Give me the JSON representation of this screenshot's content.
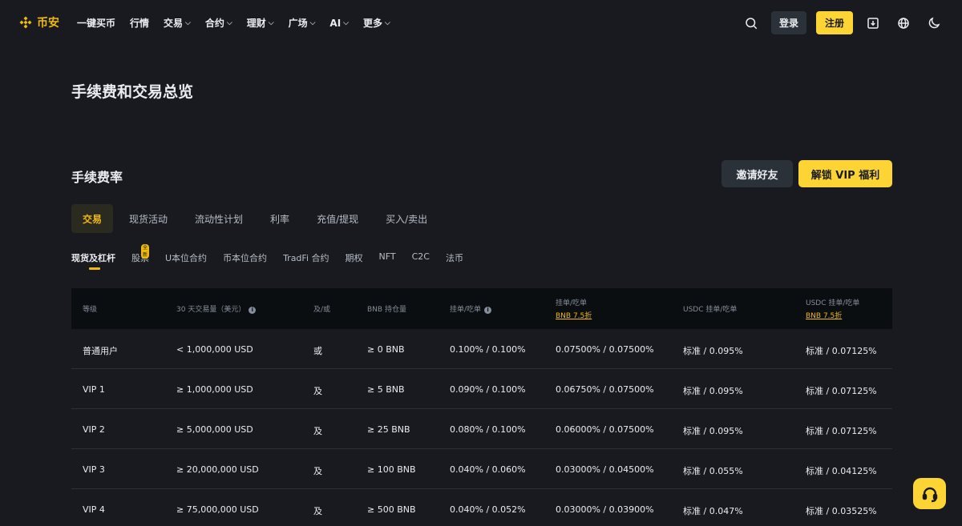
{
  "brand": {
    "name": "币安"
  },
  "nav": {
    "items": [
      {
        "label": "一键买币",
        "chevron": false
      },
      {
        "label": "行情",
        "chevron": false
      },
      {
        "label": "交易",
        "chevron": true
      },
      {
        "label": "合约",
        "chevron": true
      },
      {
        "label": "理财",
        "chevron": true
      },
      {
        "label": "广场",
        "chevron": true
      },
      {
        "label": "AI",
        "chevron": true
      },
      {
        "label": "更多",
        "chevron": true
      }
    ],
    "login_label": "登录",
    "signup_label": "注册"
  },
  "page": {
    "title": "手续费和交易总览"
  },
  "fees": {
    "section_title": "手续费率",
    "invite_label": "邀请好友",
    "vip_label": "解锁 VIP 福利",
    "tabs": [
      "交易",
      "现货活动",
      "流动性计划",
      "利率",
      "充值/提现",
      "买入/卖出"
    ],
    "active_tab": "交易",
    "subtabs": [
      "现货及杠杆",
      "股票",
      "U本位合约",
      "币本位合约",
      "TradFi 合约",
      "期权",
      "NFT",
      "C2C",
      "法币"
    ],
    "new_badge": "全新"
  },
  "table": {
    "headers": {
      "level": "等级",
      "volume": "30 天交易量（美元）",
      "andor": "及/或",
      "bnb": "BNB 持仓量",
      "maker_taker": "挂单/吃单",
      "bnb_mt": "挂单/吃单",
      "bnb_discount": "BNB 7.5折",
      "usdc_mt": "USDC 挂单/吃单",
      "usdc_bnb_mt": "USDC 挂单/吃单",
      "usdc_bnb_discount": "BNB 7.5折"
    },
    "rows": [
      {
        "level": "普通用户",
        "volume": "< 1,000,000 USD",
        "andor": "或",
        "bnb": "≥ 0 BNB",
        "mt": "0.100% / 0.100%",
        "bnb_mt": "0.07500% / 0.07500%",
        "usdc": "标准 / 0.095%",
        "usdc_bnb": "标准 / 0.07125%"
      },
      {
        "level": "VIP 1",
        "volume": "≥ 1,000,000 USD",
        "andor": "及",
        "bnb": "≥ 5 BNB",
        "mt": "0.090% / 0.100%",
        "bnb_mt": "0.06750% / 0.07500%",
        "usdc": "标准 / 0.095%",
        "usdc_bnb": "标准 / 0.07125%"
      },
      {
        "level": "VIP 2",
        "volume": "≥ 5,000,000 USD",
        "andor": "及",
        "bnb": "≥ 25 BNB",
        "mt": "0.080% / 0.100%",
        "bnb_mt": "0.06000% / 0.07500%",
        "usdc": "标准 / 0.095%",
        "usdc_bnb": "标准 / 0.07125%"
      },
      {
        "level": "VIP 3",
        "volume": "≥ 20,000,000 USD",
        "andor": "及",
        "bnb": "≥ 100 BNB",
        "mt": "0.040% / 0.060%",
        "bnb_mt": "0.03000% / 0.04500%",
        "usdc": "标准 / 0.055%",
        "usdc_bnb": "标准 / 0.04125%"
      },
      {
        "level": "VIP 4",
        "volume": "≥ 75,000,000 USD",
        "andor": "及",
        "bnb": "≥ 500 BNB",
        "mt": "0.040% / 0.052%",
        "bnb_mt": "0.03000% / 0.03900%",
        "usdc": "标准 / 0.047%",
        "usdc_bnb": "标准 / 0.03525%"
      }
    ]
  },
  "colors": {
    "accent": "#fcd535",
    "background": "#181a20",
    "header_bg": "#0b0e11"
  }
}
